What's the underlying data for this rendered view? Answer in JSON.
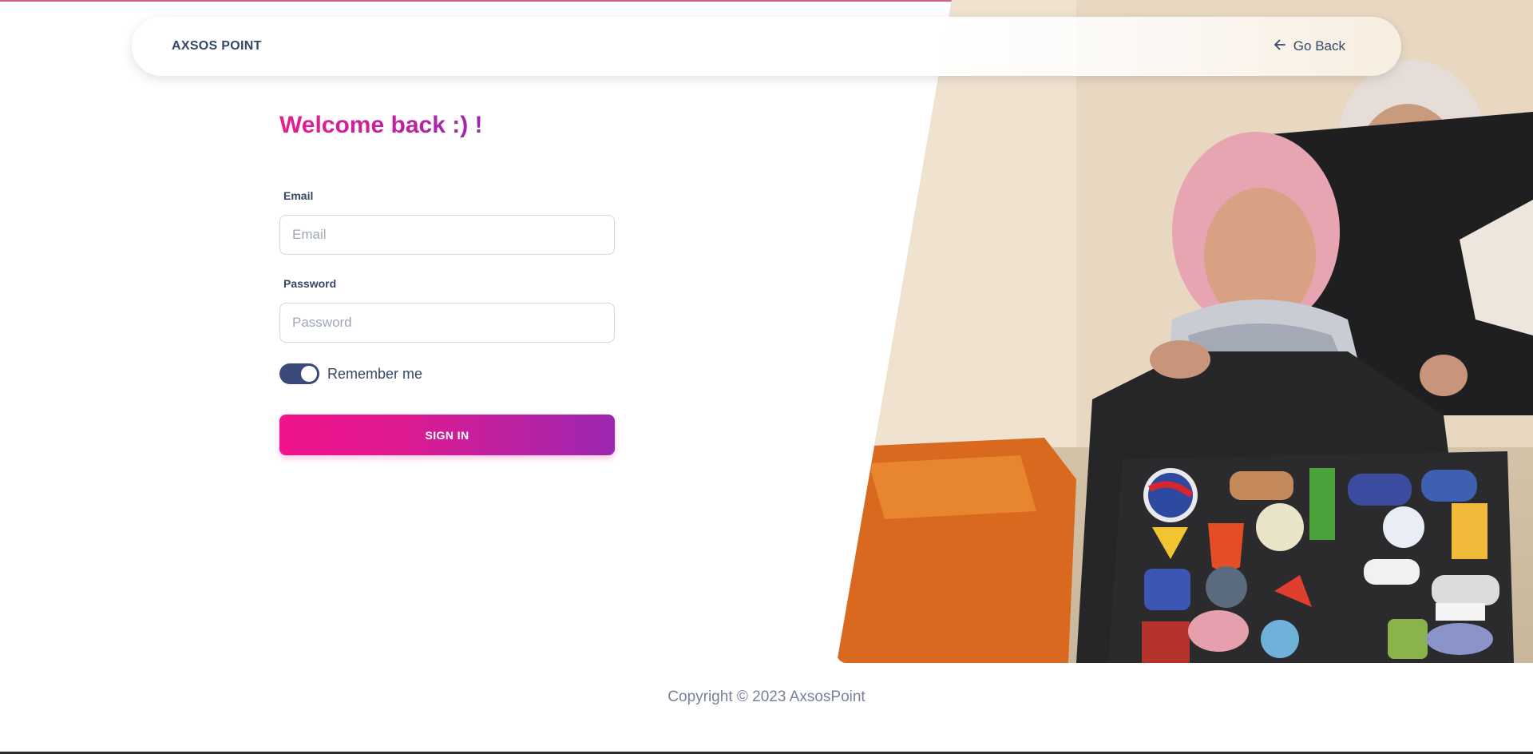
{
  "navbar": {
    "brand": "AXSOS POINT",
    "go_back_label": "Go Back"
  },
  "login": {
    "welcome": "Welcome back :) !",
    "email_label": "Email",
    "email_placeholder": "Email",
    "email_value": "",
    "password_label": "Password",
    "password_placeholder": "Password",
    "password_value": "",
    "remember_label": "Remember me",
    "remember_checked": true,
    "signin_label": "SIGN IN"
  },
  "footer": {
    "copyright": "Copyright © 2023 AxsosPoint"
  },
  "colors": {
    "accent_pink": "#e91e8c",
    "accent_purple": "#9c27b0",
    "text_dark": "#344767",
    "toggle": "#3b4a7a"
  },
  "icons": {
    "go_back": "arrow-left-icon"
  }
}
